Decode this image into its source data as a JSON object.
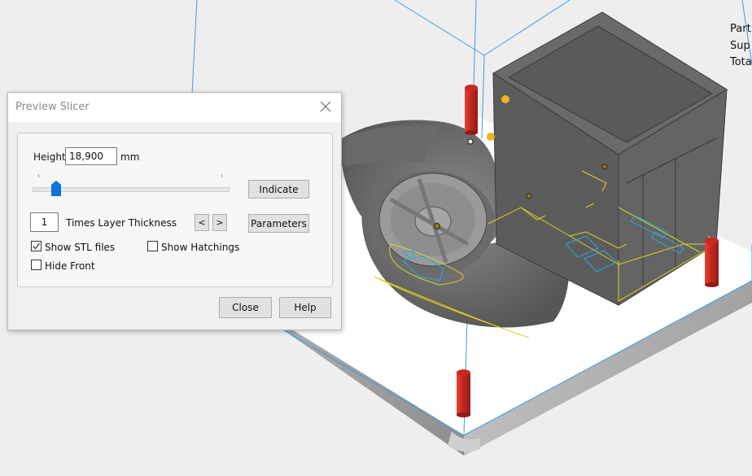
{
  "dialog": {
    "title": "Preview Slicer",
    "height_label": "Height",
    "height_value": "18,900",
    "height_unit": "mm",
    "slider_position_fraction": 0.12,
    "indicate_label": "Indicate",
    "times_value": "1",
    "times_label": "Times Layer Thickness",
    "prev_label": "<",
    "next_label": ">",
    "parameters_label": "Parameters",
    "show_stl_label": "Show STL files",
    "show_stl_checked": true,
    "show_hatchings_label": "Show Hatchings",
    "show_hatchings_checked": false,
    "hide_front_label": "Hide Front",
    "hide_front_checked": false,
    "close_label": "Close",
    "help_label": "Help"
  },
  "stats": {
    "line1": "Part",
    "line2": "Sup",
    "line3": "Tota"
  },
  "colors": {
    "background": "#eeeeee",
    "build_box": "#3d9be9",
    "support_pin": "#d0352b",
    "part_gray": "#5e5e5e",
    "slice_contour": "#e2cf1e",
    "hatch_contour": "#29a8e0",
    "slider_accent": "#0a74da"
  }
}
